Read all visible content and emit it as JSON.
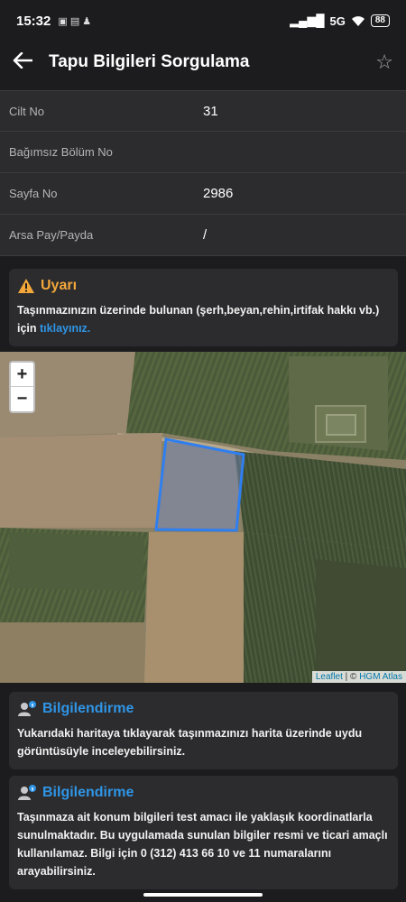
{
  "status_bar": {
    "time": "15:32",
    "network": "5G",
    "battery": "88"
  },
  "app_bar": {
    "title": "Tapu Bilgileri Sorgulama"
  },
  "table": {
    "rows": [
      {
        "label": "Cilt No",
        "value": "31"
      },
      {
        "label": "Bağımsız Bölüm No",
        "value": ""
      },
      {
        "label": "Sayfa No",
        "value": "2986"
      },
      {
        "label": "Arsa Pay/Payda",
        "value": "/"
      }
    ]
  },
  "warning": {
    "title": "Uyarı",
    "text": "Taşınmazınızın üzerinde bulunan (şerh,beyan,rehin,irtifak hakkı vb.) için ",
    "link": "tıklayınız."
  },
  "map": {
    "zoom_in": "+",
    "zoom_out": "−",
    "attribution_leaflet": "Leaflet",
    "attribution_sep": " | © ",
    "attribution_hgm": "HGM Atlas",
    "parcel_color": "#2f7ff0"
  },
  "info1": {
    "title": "Bilgilendirme",
    "text": "Yukarıdaki haritaya tıklayarak taşınmazınızı harita üzerinde uydu görüntüsüyle inceleyebilirsiniz."
  },
  "info2": {
    "title": "Bilgilendirme",
    "text": "Taşınmaza ait konum bilgileri test amacı ile yaklaşık koordinatlarla sunulmaktadır. Bu uygulamada sunulan bilgiler resmi ve ticari amaçlı kullanılamaz. Bilgi için 0 (312) 413 66 10 ve 11 numaralarını arayabilirsiniz."
  },
  "colors": {
    "background": "#1c1c1e",
    "card": "#2c2c2e",
    "warning": "#f3a73b",
    "info": "#2f95e6"
  }
}
